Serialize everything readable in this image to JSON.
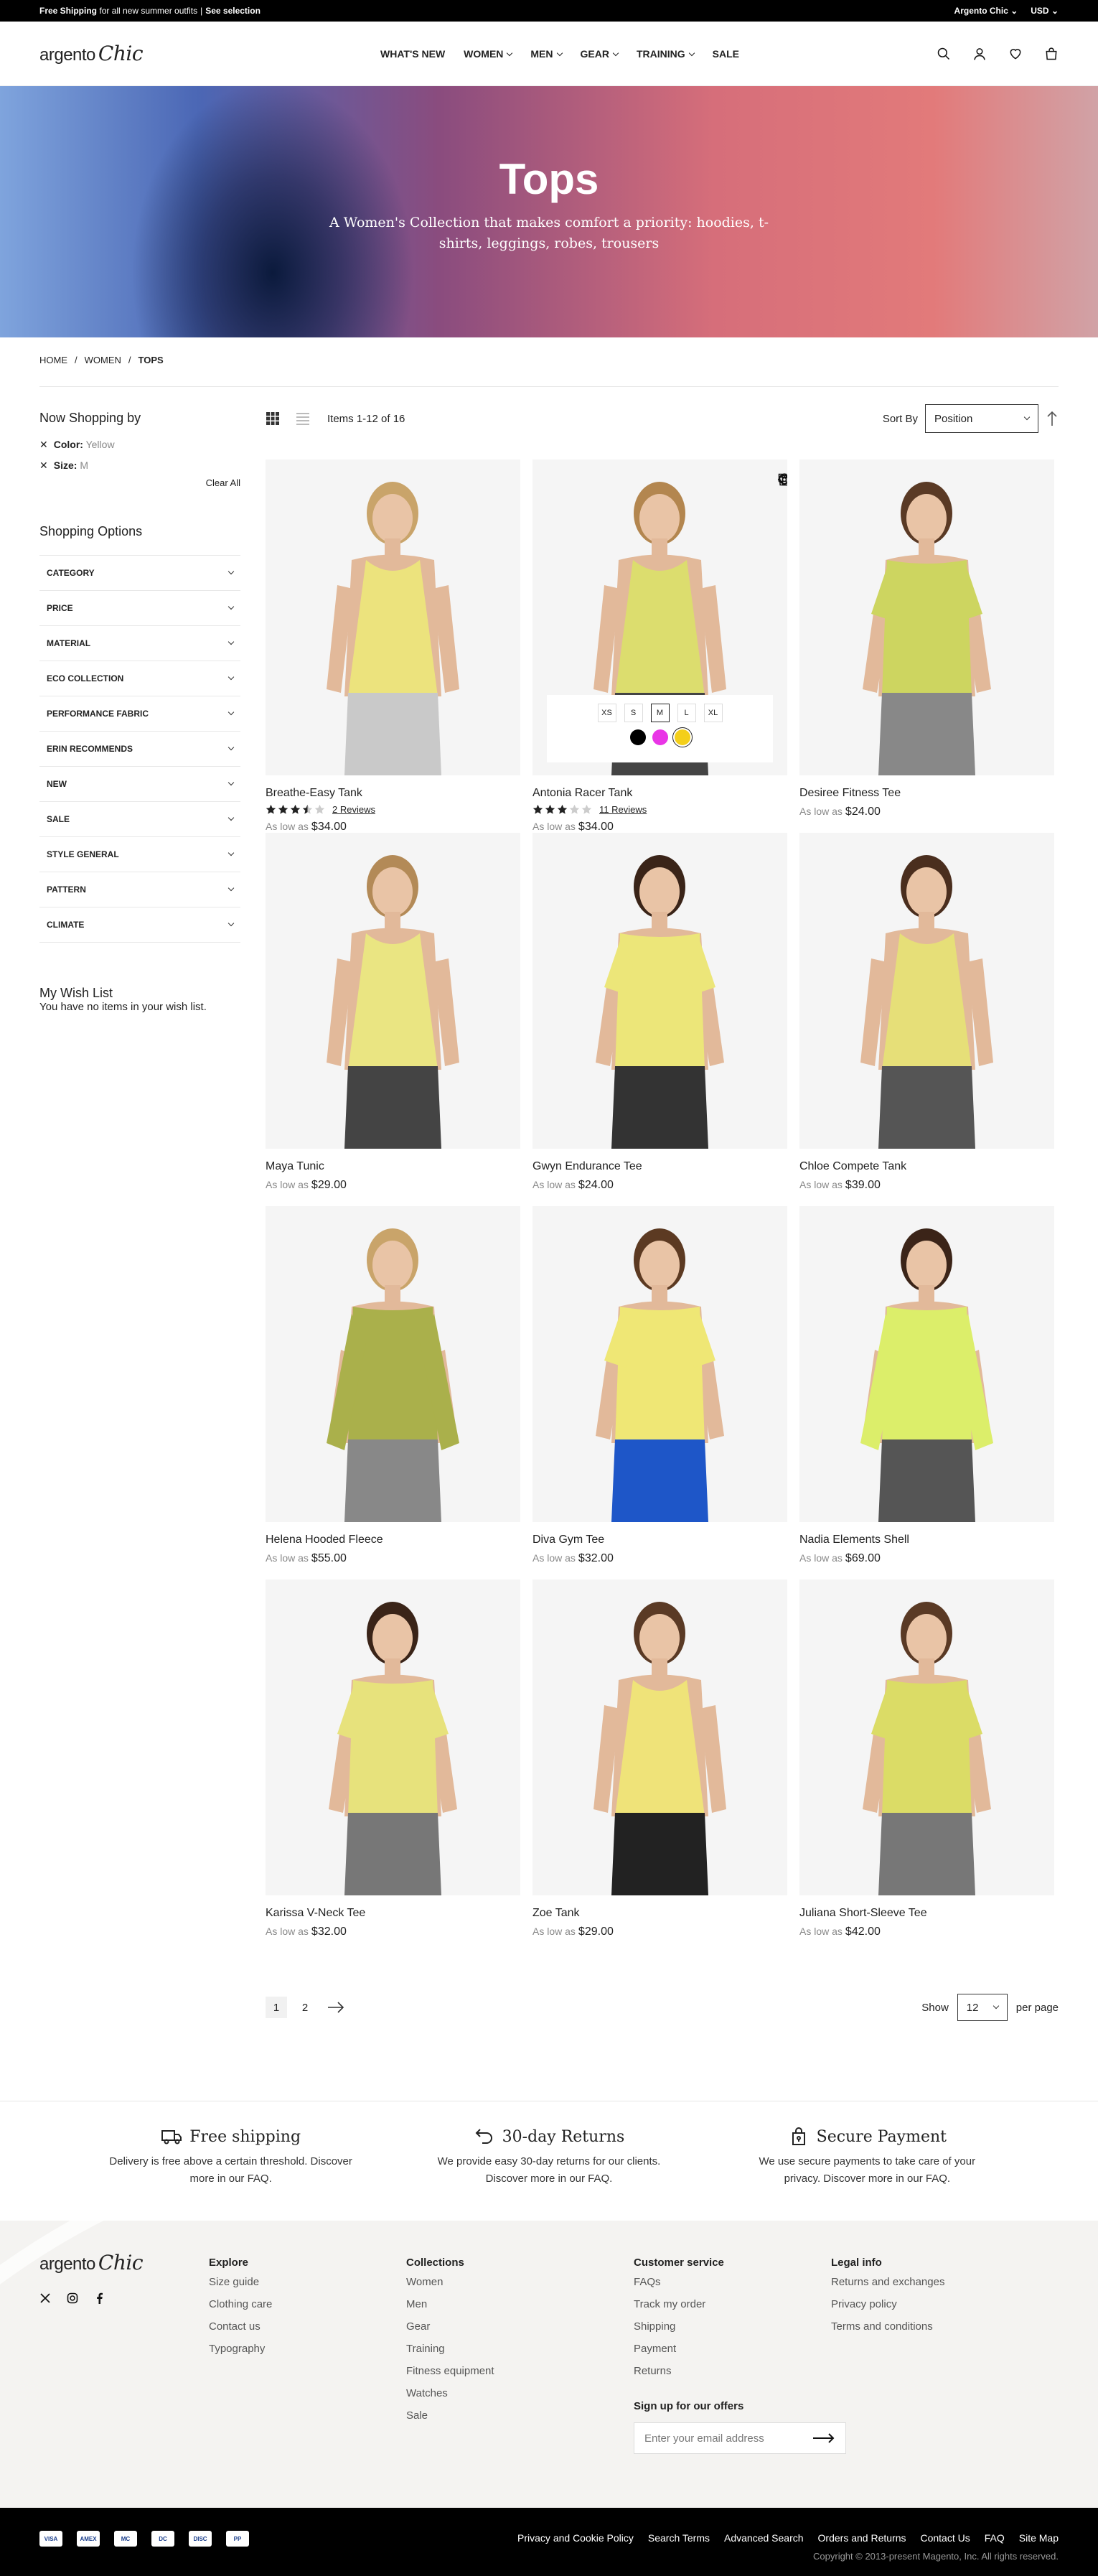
{
  "promo": {
    "strong": "Free Shipping",
    "text": "for all new summer outfits",
    "link": "See selection",
    "store": "Argento Chic",
    "currency": "USD"
  },
  "header": {
    "logo_a": "argento",
    "logo_b": "Chic",
    "nav": [
      "WHAT'S NEW",
      "WOMEN",
      "MEN",
      "GEAR",
      "TRAINING",
      "SALE"
    ]
  },
  "hero": {
    "title": "Tops",
    "subtitle": "A Women's Collection that makes comfort a priority: hoodies, t-shirts, leggings, robes, trousers"
  },
  "breadcrumb": [
    "HOME",
    "WOMEN",
    "TOPS"
  ],
  "sidebar": {
    "now_shopping": "Now Shopping by",
    "filters": [
      {
        "label": "Color:",
        "value": "Yellow"
      },
      {
        "label": "Size:",
        "value": "M"
      }
    ],
    "clear_all": "Clear All",
    "options_title": "Shopping Options",
    "options": [
      "CATEGORY",
      "PRICE",
      "MATERIAL",
      "ECO COLLECTION",
      "PERFORMANCE FABRIC",
      "ERIN RECOMMENDS",
      "NEW",
      "SALE",
      "STYLE GENERAL",
      "PATTERN",
      "CLIMATE"
    ],
    "wishlist_title": "My Wish List",
    "wishlist_text": "You have no items in your wish list."
  },
  "toolbar": {
    "items": "Items 1-12 of 16",
    "sort_label": "Sort By",
    "sort_value": "Position"
  },
  "products": [
    {
      "name": "Breathe-Easy Tank",
      "rating": 3.5,
      "reviews": "2  Reviews",
      "prefix": "As low as",
      "price": "$34.00",
      "shirt": "#ece37d",
      "pants": "#c9c9c9"
    },
    {
      "name": "Antonia Racer Tank",
      "rating": 3,
      "reviews": "11  Reviews",
      "prefix": "As low as",
      "price": "$34.00",
      "shirt": "#dcdd6e",
      "pants": "#444"
    },
    {
      "name": "Desiree Fitness Tee",
      "prefix": "As low as",
      "price": "$24.00",
      "shirt": "#cdd560",
      "pants": "#888"
    },
    {
      "name": "Maya Tunic",
      "prefix": "As low as",
      "price": "$29.00",
      "shirt": "#eae582",
      "pants": "#444"
    },
    {
      "name": "Gwyn Endurance Tee",
      "prefix": "As low as",
      "price": "$24.00",
      "shirt": "#ece679",
      "pants": "#333"
    },
    {
      "name": "Chloe Compete Tank",
      "prefix": "As low as",
      "price": "$39.00",
      "shirt": "#e6df78",
      "pants": "#555"
    },
    {
      "name": "Helena Hooded Fleece",
      "prefix": "As low as",
      "price": "$55.00",
      "shirt": "#aab04b",
      "pants": "#888"
    },
    {
      "name": "Diva Gym Tee",
      "prefix": "As low as",
      "price": "$32.00",
      "shirt": "#efe775",
      "pants": "#1e56c8"
    },
    {
      "name": "Nadia Elements Shell",
      "prefix": "As low as",
      "price": "$69.00",
      "shirt": "#dcee6a",
      "pants": "#555"
    },
    {
      "name": "Karissa V-Neck Tee",
      "prefix": "As low as",
      "price": "$32.00",
      "shirt": "#e7e27c",
      "pants": "#777"
    },
    {
      "name": "Zoe Tank",
      "prefix": "As low as",
      "price": "$29.00",
      "shirt": "#efe379",
      "pants": "#222"
    },
    {
      "name": "Juliana Short-Sleeve Tee",
      "prefix": "As low as",
      "price": "$42.00",
      "shirt": "#dbdc66",
      "pants": "#777"
    }
  ],
  "swatches": {
    "sizes": [
      "XS",
      "S",
      "M",
      "L",
      "XL"
    ],
    "selected_size": "M",
    "colors": [
      "#000000",
      "#e935e6",
      "#f4cf1a"
    ]
  },
  "pagination": {
    "pages": [
      "1",
      "2"
    ],
    "show": "Show",
    "per_page_value": "12",
    "per_page": "per page"
  },
  "features": [
    {
      "title": "Free shipping",
      "text": "Delivery is free above a certain threshold. Discover more in our FAQ.",
      "icon": "truck-icon"
    },
    {
      "title": "30-day Returns",
      "text": "We provide easy 30-day returns for our clients. Discover more in our FAQ.",
      "icon": "return-icon"
    },
    {
      "title": "Secure Payment",
      "text": "We use secure payments to take care of your privacy. Discover more in our FAQ.",
      "icon": "lock-bag-icon"
    }
  ],
  "footer": {
    "cols": [
      {
        "title": "Explore",
        "links": [
          "Size guide",
          "Clothing care",
          "Contact us",
          "Typography"
        ]
      },
      {
        "title": "Collections",
        "links": [
          "Women",
          "Men",
          "Gear",
          "Training",
          "Fitness equipment",
          "Watches",
          "Sale"
        ]
      },
      {
        "title": "Customer service",
        "links": [
          "FAQs",
          "Track my order",
          "Shipping",
          "Payment",
          "Returns"
        ]
      },
      {
        "title": "Legal info",
        "links": [
          "Returns and exchanges",
          "Privacy policy",
          "Terms and conditions"
        ]
      }
    ],
    "newsletter_title": "Sign up for our offers",
    "newsletter_placeholder": "Enter your email address"
  },
  "bottom": {
    "links": [
      "Privacy and Cookie Policy",
      "Search Terms",
      "Advanced Search",
      "Orders and Returns",
      "Contact Us",
      "FAQ",
      "Site Map"
    ],
    "copyright": "Copyright © 2013-present Magento, Inc. All rights reserved.",
    "cards": [
      "VISA",
      "AMEX",
      "MC",
      "DC",
      "DISC",
      "PP"
    ]
  }
}
